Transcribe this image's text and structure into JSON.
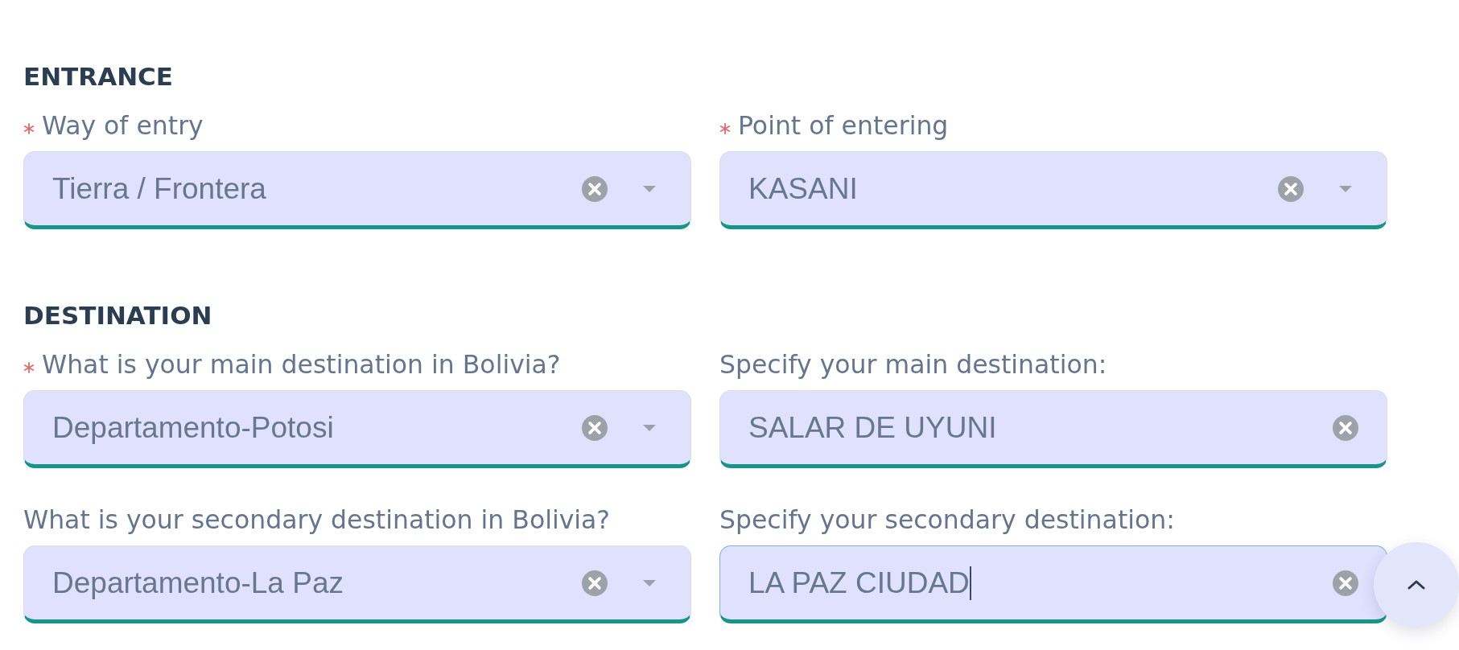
{
  "sections": [
    {
      "title": "ENTRANCE",
      "fields": [
        {
          "label": "Way of entry",
          "required": true,
          "kind": "select",
          "value": "Tierra / Frontera",
          "focused": false
        },
        {
          "label": "Point of entering",
          "required": true,
          "kind": "select",
          "value": "KASANI",
          "focused": false
        }
      ]
    },
    {
      "title": "DESTINATION",
      "fields": [
        {
          "label": "What is your main destination in Bolivia?",
          "required": true,
          "kind": "select",
          "value": "Departamento-Potosi",
          "focused": false
        },
        {
          "label": "Specify your main destination:",
          "required": false,
          "kind": "text",
          "value": "SALAR DE UYUNI",
          "focused": false
        },
        {
          "label": "What is your secondary destination in Bolivia?",
          "required": false,
          "kind": "select",
          "value": "Departamento-La Paz",
          "focused": false
        },
        {
          "label": "Specify your secondary destination:",
          "required": false,
          "kind": "text",
          "value": "LA PAZ CIUDAD",
          "focused": true
        }
      ]
    }
  ]
}
